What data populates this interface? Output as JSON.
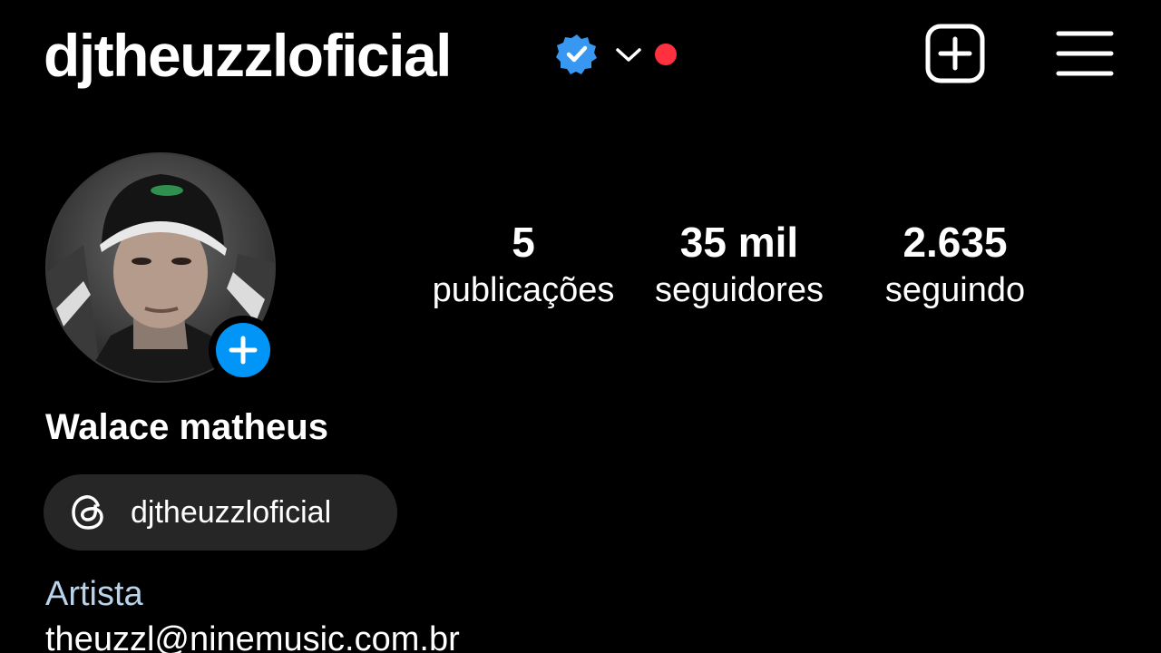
{
  "header": {
    "username": "djtheuzzloficial",
    "verified_icon": "verified-badge-icon",
    "switch_account_icon": "chevron-down-icon",
    "notification_dot_color": "#ff3040",
    "create_icon": "plus-square-icon",
    "menu_icon": "hamburger-menu-icon"
  },
  "profile": {
    "avatar_icon": "profile-photo",
    "add_story_icon": "plus-icon",
    "add_story_color": "#0095f6",
    "full_name": "Walace matheus",
    "stats": {
      "posts_count": "5",
      "posts_label": "publicações",
      "followers_count": "35 mil",
      "followers_label": "seguidores",
      "following_count": "2.635",
      "following_label": "seguindo"
    },
    "threads": {
      "icon": "threads-icon",
      "handle": "djtheuzzloficial"
    },
    "category": "Artista",
    "category_color": "#b9d3ea",
    "email": "theuzzl@ninemusic.com.br"
  }
}
